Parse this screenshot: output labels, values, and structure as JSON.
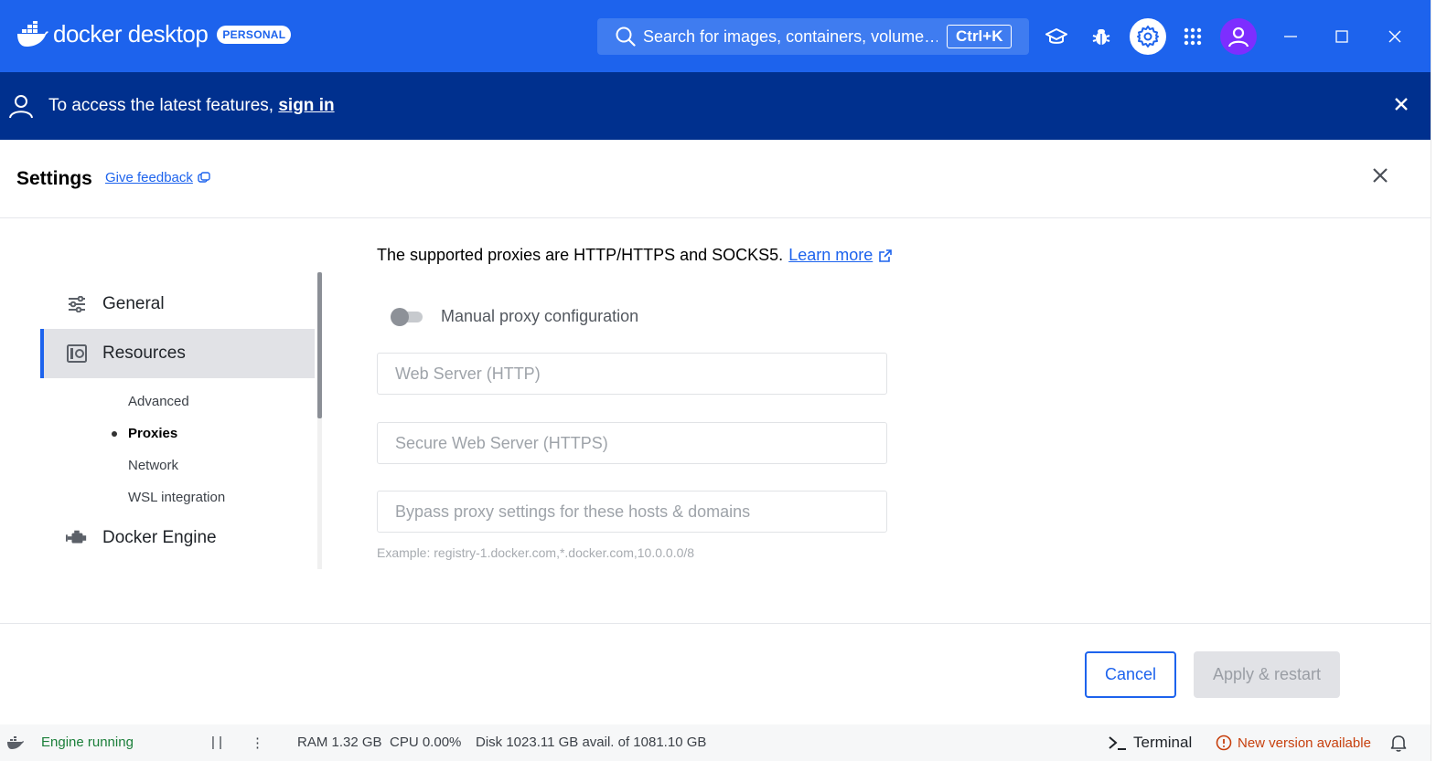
{
  "titlebar": {
    "logo_text": "docker desktop",
    "badge": "PERSONAL",
    "search_placeholder": "Search for images, containers, volume…",
    "search_shortcut": "Ctrl+K",
    "brand_color": "#1d63ed",
    "avatar_color": "#7d2eff"
  },
  "banner": {
    "text": "To access the latest features, ",
    "link": "sign in",
    "background": "#00308e"
  },
  "settings": {
    "title": "Settings",
    "feedback": "Give feedback"
  },
  "sidebar": {
    "items": [
      {
        "label": "General",
        "icon": "sliders-icon"
      },
      {
        "label": "Resources",
        "icon": "resources-icon",
        "active": true
      },
      {
        "label": "Docker Engine",
        "icon": "engine-icon"
      }
    ],
    "subitems": [
      {
        "label": "Advanced"
      },
      {
        "label": "Proxies",
        "active": true
      },
      {
        "label": "Network"
      },
      {
        "label": "WSL integration"
      }
    ]
  },
  "proxies": {
    "intro": "The supported proxies are HTTP/HTTPS and SOCKS5.",
    "learn_more": "Learn more",
    "toggle_label": "Manual proxy configuration",
    "toggle_on": false,
    "http_placeholder": "Web Server (HTTP)",
    "https_placeholder": "Secure Web Server (HTTPS)",
    "bypass_placeholder": "Bypass proxy settings for these hosts & domains",
    "bypass_hint": "Example: registry-1.docker.com,*.docker.com,10.0.0.0/8"
  },
  "footer": {
    "cancel": "Cancel",
    "apply": "Apply & restart"
  },
  "statusbar": {
    "engine": "Engine running",
    "pause": "| |",
    "more": "⋮",
    "ram": "RAM 1.32 GB",
    "cpu": "CPU 0.00%",
    "disk": "Disk 1023.11 GB avail. of 1081.10 GB",
    "terminal": "Terminal",
    "new_version": "New version available"
  }
}
